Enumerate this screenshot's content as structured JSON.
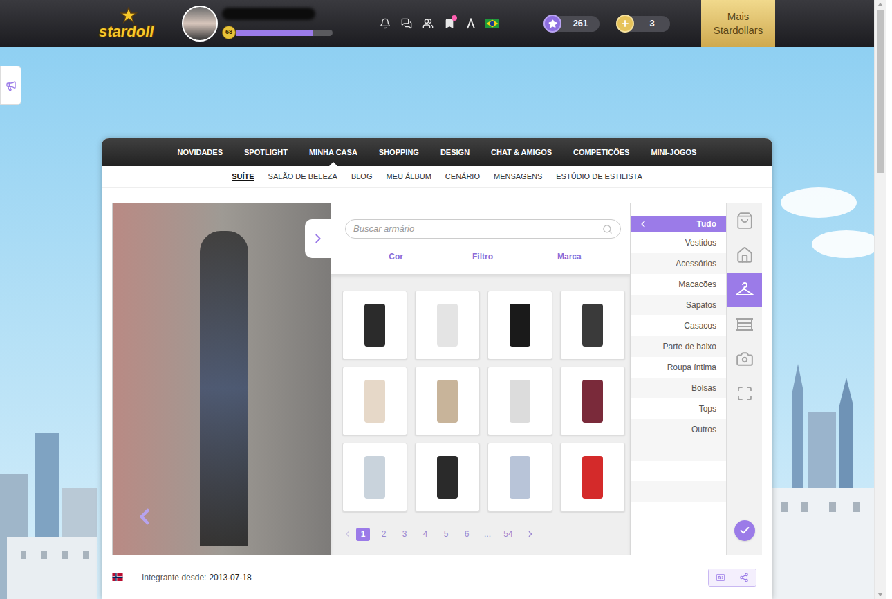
{
  "header": {
    "logo": "stardoll",
    "level": "68",
    "xp": 0.8,
    "toolbar": [
      {
        "badge": false
      },
      {
        "badge": false
      },
      {
        "badge": false
      },
      {
        "badge": true
      },
      {
        "badge": false
      },
      {
        "badge": false
      }
    ],
    "stardollars": "261",
    "coins": "3",
    "buy_button": "Mais Stardollars"
  },
  "nav": [
    {
      "label": "NOVIDADES",
      "selected": false
    },
    {
      "label": "SPOTLIGHT",
      "selected": false
    },
    {
      "label": "MINHA CASA",
      "selected": true
    },
    {
      "label": "SHOPPING",
      "selected": false
    },
    {
      "label": "DESIGN",
      "selected": false
    },
    {
      "label": "CHAT & AMIGOS",
      "selected": false
    },
    {
      "label": "COMPETIÇÕES",
      "selected": false
    },
    {
      "label": "MINI-JOGOS",
      "selected": false
    }
  ],
  "subnav": [
    {
      "label": "SUÍTE",
      "selected": true
    },
    {
      "label": "SALÃO DE BELEZA",
      "selected": false
    },
    {
      "label": "BLOG",
      "selected": false
    },
    {
      "label": "MEU ÁLBUM",
      "selected": false
    },
    {
      "label": "CENÁRIO",
      "selected": false
    },
    {
      "label": "MENSAGENS",
      "selected": false
    },
    {
      "label": "ESTÚDIO DE ESTILISTA",
      "selected": false
    }
  ],
  "wardrobe": {
    "search_placeholder": "Buscar armário",
    "filters": [
      "Cor",
      "Filtro",
      "Marca"
    ],
    "items": [
      {
        "color": "#2b2b2b"
      },
      {
        "color": "#e4e4e4"
      },
      {
        "color": "#1a1a1a"
      },
      {
        "color": "#3a3a3a"
      },
      {
        "color": "#e6d8c8"
      },
      {
        "color": "#c8b49a"
      },
      {
        "color": "#dcdcdc"
      },
      {
        "color": "#7a2a3a"
      },
      {
        "color": "#c9d3dc"
      },
      {
        "color": "#2a2a2a"
      },
      {
        "color": "#b8c4d8"
      },
      {
        "color": "#d42a2a"
      }
    ],
    "pages": [
      {
        "label": "1",
        "selected": true
      },
      {
        "label": "2",
        "selected": false
      },
      {
        "label": "3",
        "selected": false
      },
      {
        "label": "4",
        "selected": false
      },
      {
        "label": "5",
        "selected": false
      },
      {
        "label": "6",
        "selected": false
      },
      {
        "label": "...",
        "selected": false
      },
      {
        "label": "54",
        "selected": false
      }
    ]
  },
  "categories": {
    "current": "Tudo",
    "items": [
      {
        "label": "Vestidos",
        "selected": false
      },
      {
        "label": "Acessórios",
        "selected": false
      },
      {
        "label": "Macacões",
        "selected": false
      },
      {
        "label": "Sapatos",
        "selected": false
      },
      {
        "label": "Casacos",
        "selected": false
      },
      {
        "label": "Parte de baixo",
        "selected": false
      },
      {
        "label": "Roupa íntima",
        "selected": false
      },
      {
        "label": "Bolsas",
        "selected": false
      },
      {
        "label": "Tops",
        "selected": false
      },
      {
        "label": "Outros",
        "selected": false
      }
    ]
  },
  "tools": [
    {
      "selected": false
    },
    {
      "selected": false
    },
    {
      "selected": true
    },
    {
      "selected": false
    },
    {
      "selected": false
    },
    {
      "selected": false
    }
  ],
  "profile": {
    "member_label": "Integrante desde:",
    "member_since": "2013-07-18"
  }
}
